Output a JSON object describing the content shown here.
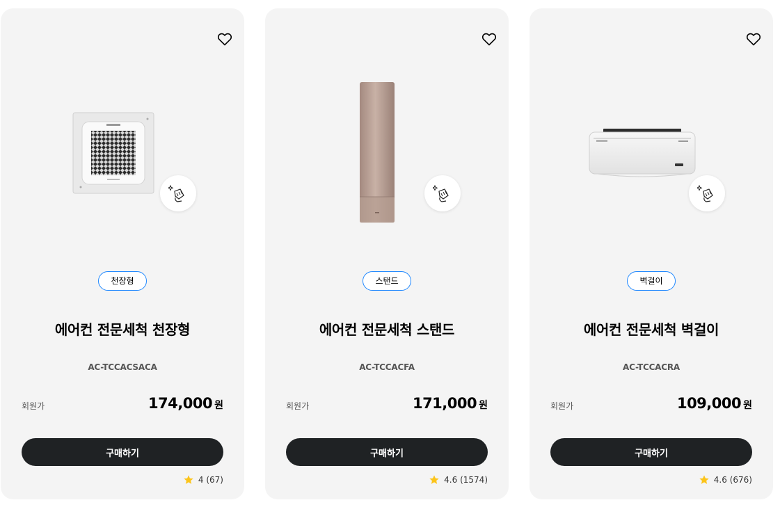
{
  "icons": {
    "wish": "heart-outline-icon",
    "clean": "hand-cleaning-icon",
    "star": "star-icon"
  },
  "colors": {
    "badge_border": "#2189ff",
    "button_bg": "#1f2224",
    "star": "#fcc419",
    "card_bg": "#f4f4f4"
  },
  "products": [
    {
      "type": "천장형",
      "title": "에어컨 전문세척 천장형",
      "model": "AC-TCCACSACA",
      "price_label": "회원가",
      "price": "174,000",
      "unit": "원",
      "buy_label": "구매하기",
      "rating": "4",
      "review_count": "(67)",
      "image": "ceiling-cassette-air-conditioner"
    },
    {
      "type": "스탠드",
      "title": "에어컨 전문세척 스탠드",
      "model": "AC-TCCACFA",
      "price_label": "회원가",
      "price": "171,000",
      "unit": "원",
      "buy_label": "구매하기",
      "rating": "4.6",
      "review_count": "(1574)",
      "image": "stand-air-conditioner"
    },
    {
      "type": "벽걸이",
      "title": "에어컨 전문세척 벽걸이",
      "model": "AC-TCCACRA",
      "price_label": "회원가",
      "price": "109,000",
      "unit": "원",
      "buy_label": "구매하기",
      "rating": "4.6",
      "review_count": "(676)",
      "image": "wall-mounted-air-conditioner"
    }
  ]
}
